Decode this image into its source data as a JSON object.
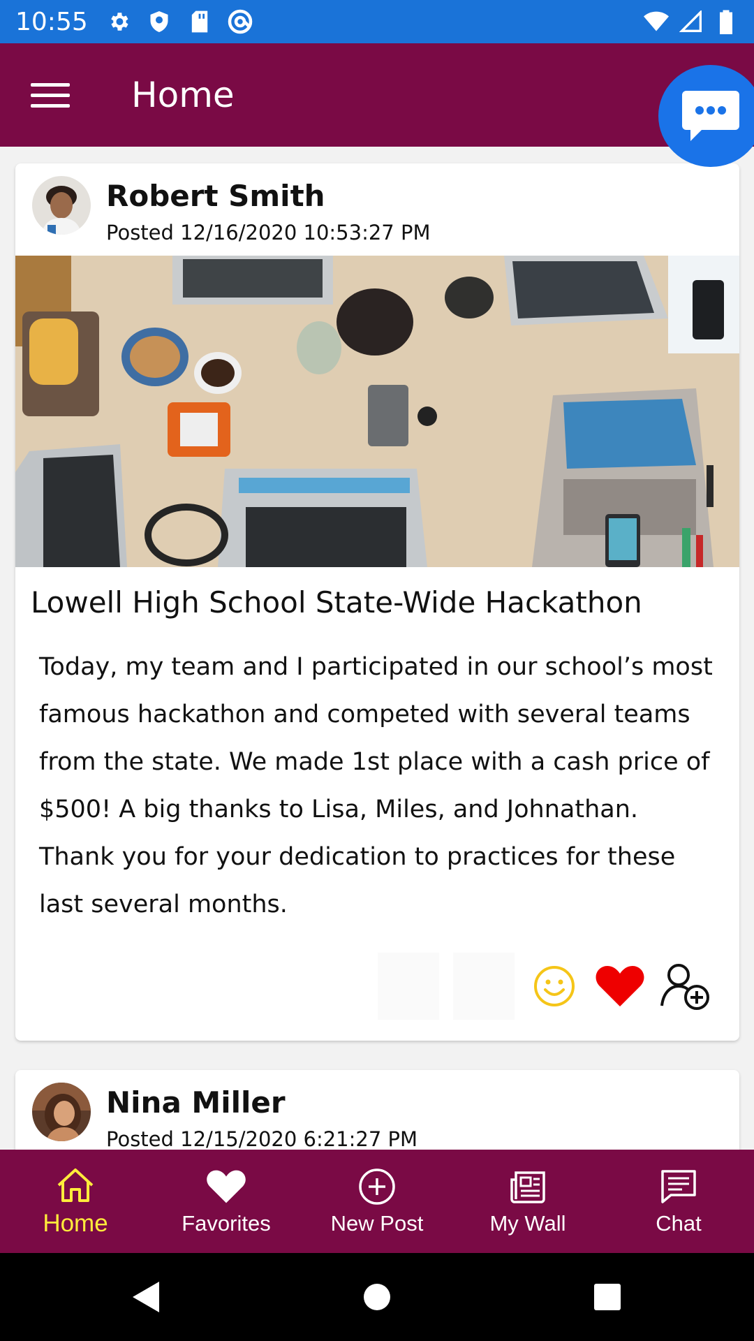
{
  "status_bar": {
    "time": "10:55",
    "left_icons": [
      "settings-icon",
      "shield-icon",
      "sd-card-icon",
      "at-sign-icon"
    ],
    "right_icons": [
      "wifi-icon",
      "signal-icon",
      "battery-icon"
    ]
  },
  "app_bar": {
    "title": "Home",
    "menu_icon": "hamburger-menu-icon",
    "fab_icon": "chat-bubble-icon"
  },
  "posts": [
    {
      "author": "Robert Smith",
      "posted": "Posted 12/16/2020 10:53:27 PM",
      "title": "Lowell High School State-Wide Hackathon",
      "body": "Today, my team and I participated in our school’s most famous hackathon and competed with several teams from the state. We made 1st place with a cash price of $500! A big thanks to Lisa, Miles, and Johnathan. Thank you for your dedication to practices for these last several months.",
      "actions": [
        "smile-icon",
        "heart-icon",
        "add-friend-icon"
      ]
    },
    {
      "author": "Nina Miller",
      "posted": "Posted 12/15/2020 6:21:27 PM"
    }
  ],
  "bottom_nav": [
    {
      "label": "Home",
      "icon": "home-icon",
      "active": true
    },
    {
      "label": "Favorites",
      "icon": "heart-icon",
      "active": false
    },
    {
      "label": "New Post",
      "icon": "plus-circle-icon",
      "active": false
    },
    {
      "label": "My Wall",
      "icon": "newspaper-icon",
      "active": false
    },
    {
      "label": "Chat",
      "icon": "message-icon",
      "active": false
    }
  ],
  "colors": {
    "status_bar": "#1a73d8",
    "primary": "#7a0a45",
    "active_nav": "#ffeb3b",
    "fab": "#1a73e8",
    "heart": "#ee0000",
    "smile": "#f5c518"
  }
}
